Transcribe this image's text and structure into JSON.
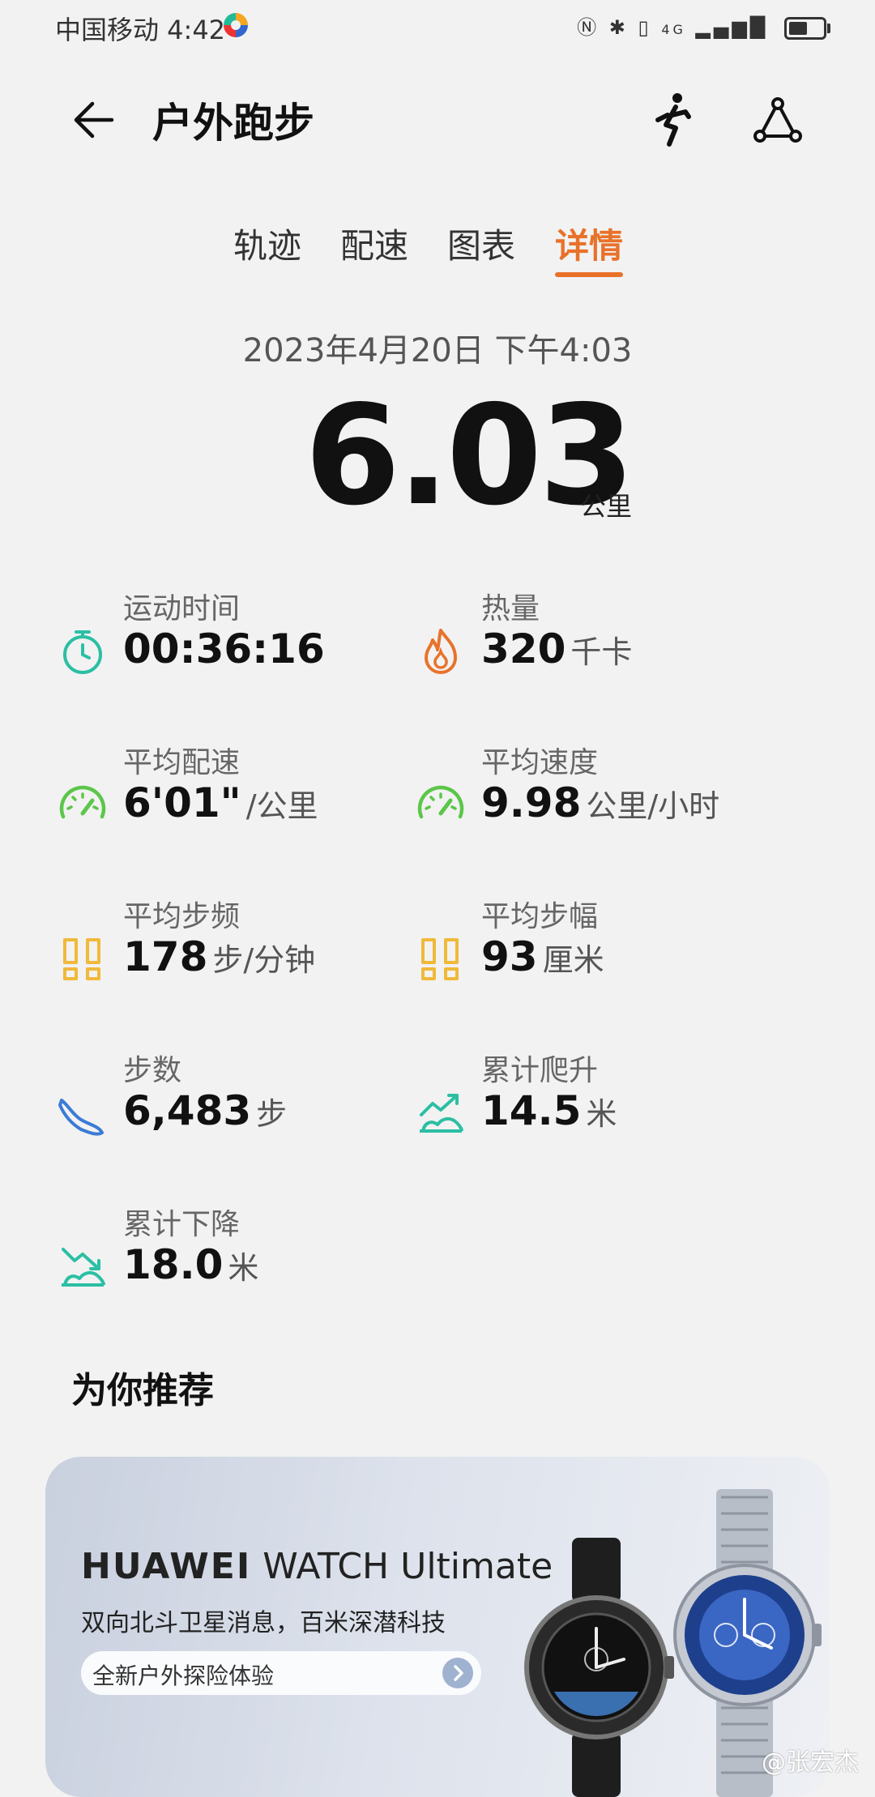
{
  "status": {
    "carrier_time": "中国移动 4:42",
    "network": "4G",
    "battery_level": 0.55
  },
  "header": {
    "title": "户外跑步"
  },
  "tabs": [
    {
      "label": "轨迹"
    },
    {
      "label": "配速"
    },
    {
      "label": "图表"
    },
    {
      "label": "详情",
      "active": true
    }
  ],
  "summary": {
    "date": "2023年4月20日 下午4:03",
    "distance": "6.03",
    "distance_unit": "公里"
  },
  "metrics": {
    "duration": {
      "label": "运动时间",
      "value": "00:36:16",
      "unit": ""
    },
    "calories": {
      "label": "热量",
      "value": "320",
      "unit": "千卡"
    },
    "avg_pace": {
      "label": "平均配速",
      "value": "6'01\"",
      "unit": "/公里"
    },
    "avg_speed": {
      "label": "平均速度",
      "value": "9.98",
      "unit": "公里/小时"
    },
    "cadence": {
      "label": "平均步频",
      "value": "178",
      "unit": "步/分钟"
    },
    "stride": {
      "label": "平均步幅",
      "value": "93",
      "unit": "厘米"
    },
    "steps": {
      "label": "步数",
      "value": "6,483",
      "unit": "步"
    },
    "ascent": {
      "label": "累计爬升",
      "value": "14.5",
      "unit": "米"
    },
    "descent": {
      "label": "累计下降",
      "value": "18.0",
      "unit": "米"
    }
  },
  "recommend": {
    "title": "为你推荐",
    "brand_bold": "HUAWEI",
    "brand_rest": "WATCH Ultimate",
    "subtitle": "双向北斗卫星消息，百米深潜科技",
    "cta": "全新户外探险体验"
  },
  "watermark": "@张宏杰",
  "colors": {
    "accent": "#e8722a",
    "teal": "#2bbfa4",
    "green": "#5cc64a",
    "yellow": "#f0b93a",
    "blue": "#3a7bd5",
    "orange": "#e8722a"
  }
}
